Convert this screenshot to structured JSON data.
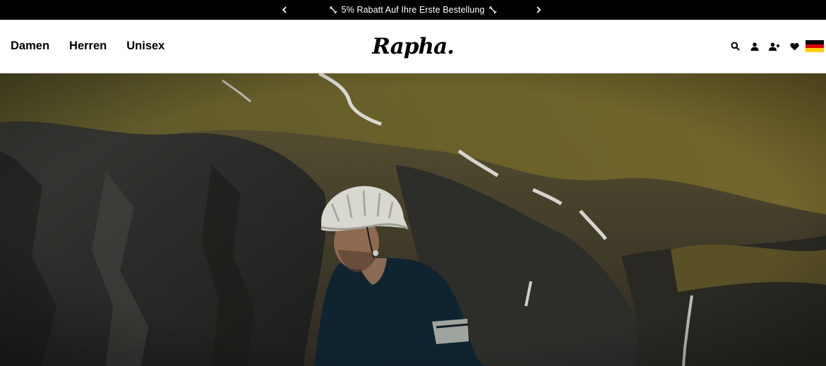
{
  "promo": {
    "message": "5% Rabatt Auf Ihre Erste Bestellung",
    "prev_icon": "chevron-left-icon",
    "next_icon": "chevron-right-icon",
    "tag_icon": "tag-icon"
  },
  "nav": {
    "items": [
      {
        "label": "Damen"
      },
      {
        "label": "Herren"
      },
      {
        "label": "Unisex"
      }
    ]
  },
  "logo": {
    "text": "Rapha."
  },
  "actions": {
    "icons": [
      "search-icon",
      "account-icon",
      "add-user-icon",
      "wishlist-heart-icon",
      "germany-flag-icon"
    ]
  },
  "colors": {
    "promo_bg": "#000000",
    "header_bg": "#ffffff",
    "flag": [
      "#000000",
      "#dd0000",
      "#ffce00"
    ]
  },
  "hero": {
    "icon": "hero-image",
    "description": ""
  }
}
